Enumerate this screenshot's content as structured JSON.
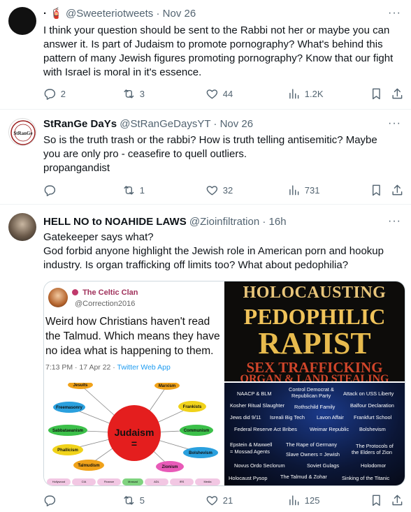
{
  "tweets": [
    {
      "name": "",
      "badge": "· 🧯",
      "handle": "@Sweeteriotweets",
      "time": "Nov 26",
      "lines": [
        "I think your question should be sent to the Rabbi not her or maybe you can",
        "answer it. Is part of Judaism to promote pornography? What's behind this",
        "pattern of many Jewish figures promoting pornography? Know that our fight",
        "with Israel is moral in it's essence."
      ],
      "replies": "2",
      "reposts": "3",
      "likes": "44",
      "views": "1.2K"
    },
    {
      "name": "StRanGe DaYs",
      "handle": "@StRanGeDaysYT",
      "time": "Nov 26",
      "avatar_text": "StRanGe",
      "lines": [
        "So is the truth trash or the rabbi? How is truth telling antisemitic? Maybe",
        "you are only pro - ceasefire to quell outliers.",
        "propangandist"
      ],
      "replies": "",
      "reposts": "1",
      "likes": "32",
      "views": "731"
    },
    {
      "name": "HELL NO to NOAHIDE LAWS",
      "handle": "@Zioinfiltration",
      "time": "16h",
      "lines": [
        "Gatekeeper says what?",
        "God forbid anyone highlight the Jewish role in American porn and hookup",
        "industry. Is organ trafficking off limits too? What about pedophilia?"
      ],
      "replies": "",
      "reposts": "5",
      "likes": "21",
      "views": "125",
      "media": {
        "quote_name": "The Celtic Clan",
        "quote_handle": "@Correction2016",
        "quote_lines": [
          "Weird how Christians haven't read",
          "the Talmud. Which means they have",
          "no idea what is happening to them."
        ],
        "quote_meta": "7:13 PM · 17 Apr 22 · ",
        "quote_app": "Twitter Web App",
        "center": "Judaism",
        "center_sym": "=",
        "nodes": [
          "Jesuits",
          "Marxism",
          "Freemasonry",
          "Frankists",
          "Sabbataeanism",
          "Communism",
          "Phallicism",
          "Bolshevism",
          "Talmudism",
          "Zionism"
        ],
        "bottom_row": [
          "Hollywood",
          "CIA",
          "Finance",
          "Mossad",
          "ADL",
          "IRS",
          "Media"
        ],
        "poster_lines": [
          "HOLOCAUSTING",
          "PEDOPHILIC",
          "RAPIST",
          "SEX TRAFFICKING",
          "ORGAN & LAND STEALING"
        ],
        "list": [
          "NAACP & BLM",
          "Control Democrat &",
          "Republican Party",
          "Attack on USS Liberty",
          "Kosher Ritual Slaughter",
          "Rothschild Family",
          "Balfour Declaration",
          "Jews did 9/11",
          "Isreali Big Tech",
          "Lavon Affair",
          "Frankfurt School",
          "Federal Reserve Act Bribes",
          "Weimar Republic",
          "Bolshevism",
          "Epstein & Maxwell",
          "= Mossad Agents",
          "The Rape of Germany",
          "Slave Owners = Jewish",
          "The Protocols of",
          "the Elders of Zion",
          "Novus Ordo Seclorum",
          "Soviet Gulags",
          "Holodomor",
          "Holocaust Pysop",
          "The Talmud & Zohar",
          "Sinking of the Titanic"
        ]
      }
    }
  ]
}
